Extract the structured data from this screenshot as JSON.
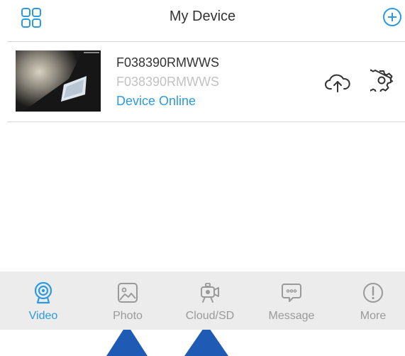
{
  "header": {
    "title": "My Device"
  },
  "device": {
    "name": "F038390RMWWS",
    "subtitle": "F038390RMWWS",
    "status": "Device Online"
  },
  "tabs": [
    {
      "label": "Video",
      "icon": "camera-icon",
      "active": true
    },
    {
      "label": "Photo",
      "icon": "image-icon",
      "active": false
    },
    {
      "label": "Cloud/SD",
      "icon": "video-camera-icon",
      "active": false
    },
    {
      "label": "Message",
      "icon": "message-icon",
      "active": false
    },
    {
      "label": "More",
      "icon": "info-icon",
      "active": false
    }
  ],
  "colors": {
    "accent": "#2d9ae0",
    "tab_inactive": "#9a9a9a",
    "tabbar_bg": "#ececec",
    "annotation_arrow": "#1f5bb5"
  }
}
